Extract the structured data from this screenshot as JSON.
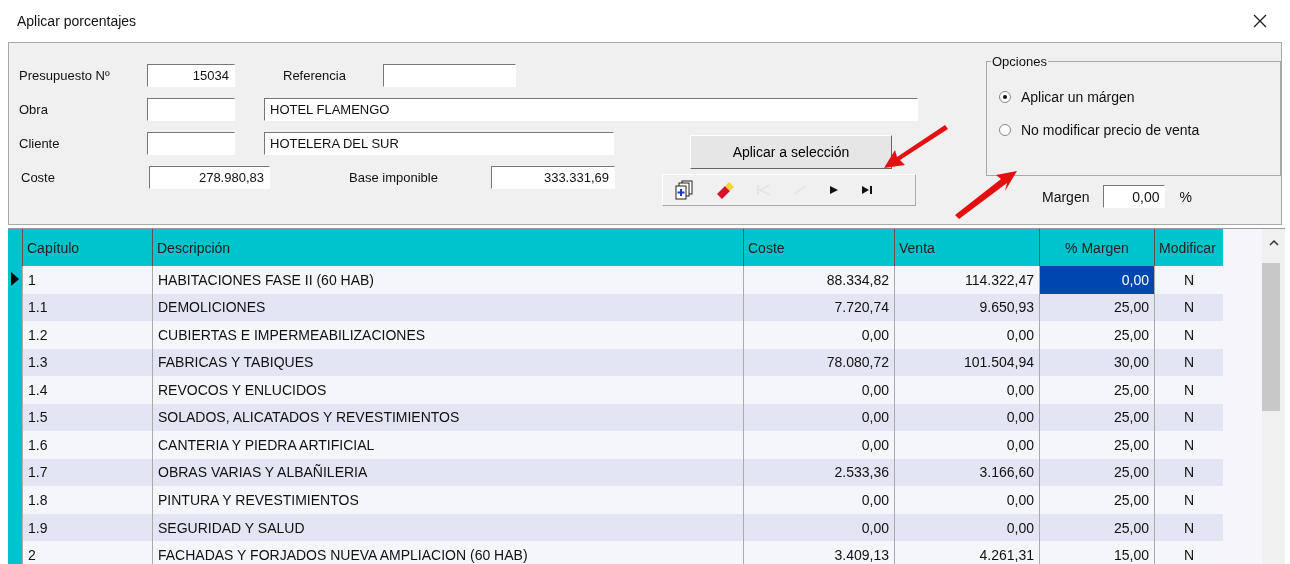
{
  "window": {
    "title": "Aplicar porcentajes"
  },
  "form": {
    "presupuesto_label": "Presupuesto Nº",
    "presupuesto": "15034",
    "referencia_label": "Referencia",
    "obra_label": "Obra",
    "obra": "HOTEL FLAMENGO",
    "cliente_label": "Cliente",
    "cliente": "HOTELERA DEL SUR",
    "coste_label": "Coste",
    "coste": "278.980,83",
    "base_label": "Base imponible",
    "base": "333.331,69"
  },
  "apply_button": "Aplicar a selección",
  "toolbar": [
    {
      "kind": "add-pages",
      "disabled": false
    },
    {
      "kind": "eraser",
      "disabled": false
    },
    {
      "kind": "first",
      "disabled": true
    },
    {
      "kind": "prev",
      "disabled": true
    },
    {
      "kind": "next",
      "disabled": false
    },
    {
      "kind": "last",
      "disabled": false
    }
  ],
  "options": {
    "title": "Opciones",
    "items": [
      {
        "label": "Aplicar un márgen",
        "selected": true
      },
      {
        "label": "No modificar precio de venta",
        "selected": false
      }
    ]
  },
  "margin": {
    "label": "Margen",
    "value": "0,00",
    "unit": "%"
  },
  "table": {
    "columns": [
      "Capítulo",
      "Descripción",
      "Coste",
      "Venta",
      "% Margen",
      "Modificar"
    ],
    "rows": [
      {
        "selected": true,
        "cells": [
          "1",
          "HABITACIONES FASE II (60 HAB)",
          "88.334,82",
          "114.322,47",
          "0,00",
          "N"
        ]
      },
      {
        "selected": false,
        "cells": [
          "1.1",
          "DEMOLICIONES",
          "7.720,74",
          "9.650,93",
          "25,00",
          "N"
        ]
      },
      {
        "selected": false,
        "cells": [
          "1.2",
          "CUBIERTAS E IMPERMEABILIZACIONES",
          "0,00",
          "0,00",
          "25,00",
          "N"
        ]
      },
      {
        "selected": false,
        "cells": [
          "1.3",
          "FABRICAS Y TABIQUES",
          "78.080,72",
          "101.504,94",
          "30,00",
          "N"
        ]
      },
      {
        "selected": false,
        "cells": [
          "1.4",
          "REVOCOS Y ENLUCIDOS",
          "0,00",
          "0,00",
          "25,00",
          "N"
        ]
      },
      {
        "selected": false,
        "cells": [
          "1.5",
          "SOLADOS, ALICATADOS Y REVESTIMIENTOS",
          "0,00",
          "0,00",
          "25,00",
          "N"
        ]
      },
      {
        "selected": false,
        "cells": [
          "1.6",
          "CANTERIA Y PIEDRA ARTIFICIAL",
          "0,00",
          "0,00",
          "25,00",
          "N"
        ]
      },
      {
        "selected": false,
        "cells": [
          "1.7",
          "OBRAS VARIAS Y ALBAÑILERIA",
          "2.533,36",
          "3.166,60",
          "25,00",
          "N"
        ]
      },
      {
        "selected": false,
        "cells": [
          "1.8",
          "PINTURA Y REVESTIMIENTOS",
          "0,00",
          "0,00",
          "25,00",
          "N"
        ]
      },
      {
        "selected": false,
        "cells": [
          "1.9",
          "SEGURIDAD Y SALUD",
          "0,00",
          "0,00",
          "25,00",
          "N"
        ]
      },
      {
        "selected": false,
        "cells": [
          "2",
          "FACHADAS Y FORJADOS NUEVA AMPLIACION (60 HAB)",
          "3.409,13",
          "4.261,31",
          "15,00",
          "N"
        ]
      }
    ]
  }
}
